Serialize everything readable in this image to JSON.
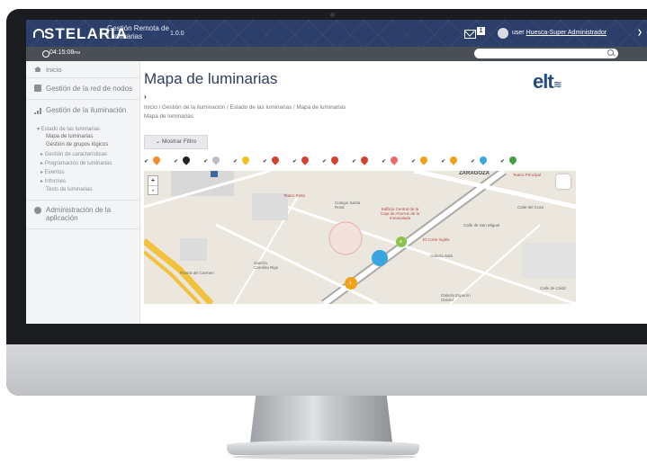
{
  "header": {
    "brand": "STELARIA",
    "tagline": "Gestión Remota de Luminarias",
    "version": "1.0.0",
    "mail_count": "1",
    "user_prefix": "user",
    "user_name": "Huesca-Super Administrador"
  },
  "subbar": {
    "clock": "04:15:08",
    "clock_suffix": "PM"
  },
  "sidebar": {
    "items": [
      {
        "label": "Inicio",
        "icon": "home-icon"
      },
      {
        "label": "Gestión de la red de nodos",
        "icon": "network-icon"
      },
      {
        "label": "Gestión de la iluminación",
        "icon": "bar-chart-icon"
      },
      {
        "label": "Administración de la aplicación",
        "icon": "gear-icon"
      }
    ],
    "lighting_sub": [
      "Estado de las luminarias",
      "Mapa de luminarias",
      "Gestión de grupos lógicos",
      "Gestión de características",
      "Programación de luminarias",
      "Eventos",
      "Informes",
      "Tests de luminarias"
    ]
  },
  "main": {
    "title": "Mapa de luminarias",
    "logo": "elt",
    "breadcrumb": "Inicio / Gestión de la iluminación / Estado de las luminarias / Mapa de luminarias",
    "breadcrumb_current": "Mapa de luminarias",
    "filter_button": "Mostrar Filtro"
  },
  "legend_colors": [
    "#f28c28",
    "#222222",
    "#b9c0c8",
    "#f2c21b",
    "#d6402f",
    "#d6402f",
    "#d6402f",
    "#d6402f",
    "#e86a6a",
    "#f2a11b",
    "#f2a11b",
    "#3aa6e0",
    "#43a047"
  ],
  "map": {
    "labels": [
      "ZARAGOZA",
      "Teatro Principal",
      "Teatro Fleta",
      "Colegio Santa Rosa",
      "Calle del Coso",
      "Calle de San Miguel",
      "Galería Sala",
      "Galería Carolina Rigo",
      "Galería Esporrin Onivito",
      "Puerta del Carmen",
      "El Corte Inglés",
      "Calle de Cádiz"
    ],
    "red_labels": [
      "Edificio Central de la Caja de Ahorros de la Inmaculada"
    ],
    "cluster_labels": [
      "2",
      "1"
    ]
  },
  "colors": {
    "topbar": "#2c3f6b",
    "accent": "#274b7a"
  }
}
